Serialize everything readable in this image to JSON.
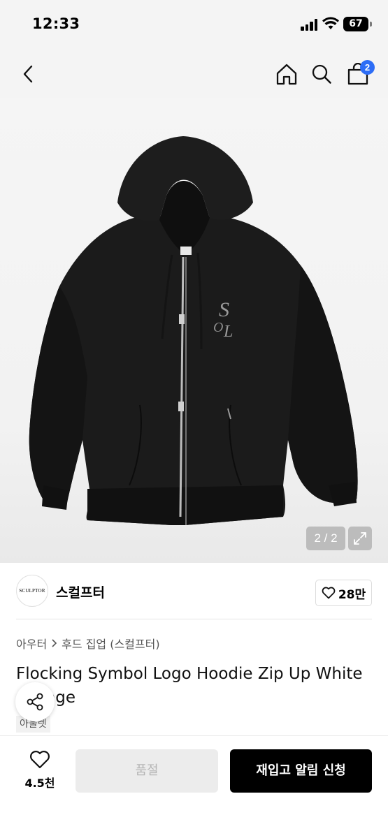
{
  "status_bar": {
    "time": "12:33",
    "battery": "67"
  },
  "nav": {
    "back_icon": "chevron-left-icon",
    "home_icon": "home-icon",
    "search_icon": "search-icon",
    "cart_icon": "shopping-bag-icon",
    "cart_badge": "2",
    "badge_color": "#2d6df6"
  },
  "gallery": {
    "counter": "2 / 2",
    "expand_icon": "expand-icon"
  },
  "brand": {
    "logo_text": "SCULPTOR",
    "name": "스컬프터",
    "likes": "28만"
  },
  "breadcrumb": {
    "category": "아우터",
    "subcategory": "후드 집업 (스컬프터)"
  },
  "product": {
    "title": "Flocking Symbol Logo Hoodie Zip Up White Orange",
    "tag": "아울렛"
  },
  "bottom_bar": {
    "wishlist_count": "4.5천",
    "soldout_label": "품절",
    "restock_label": "재입고 알림 신청"
  }
}
